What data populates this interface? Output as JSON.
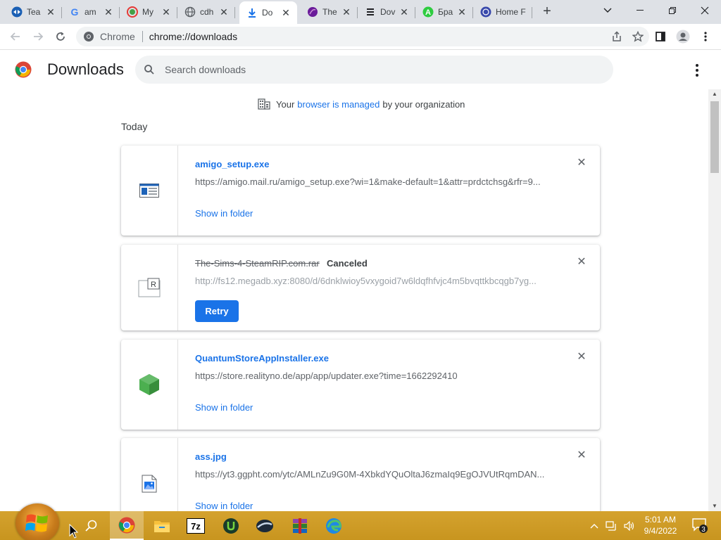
{
  "browser": {
    "tabs": [
      {
        "title": "Tea",
        "icon": "teamviewer-icon",
        "color": "#1a5fb4"
      },
      {
        "title": "am",
        "icon": "google-icon",
        "color": "#4285f4"
      },
      {
        "title": "My",
        "icon": "mywot-icon",
        "color": "#e53935"
      },
      {
        "title": "cdh",
        "icon": "globe-icon",
        "color": "#5f6368"
      },
      {
        "title": "Do",
        "icon": "download-icon",
        "color": "#1a73e8",
        "active": true
      },
      {
        "title": "The",
        "icon": "purple-orb-icon",
        "color": "#6a1b9a"
      },
      {
        "title": "Dov",
        "icon": "stack-icon",
        "color": "#202124"
      },
      {
        "title": "Бра",
        "icon": "amigo-icon",
        "color": "#2ecc40"
      },
      {
        "title": "Home F",
        "icon": "site-icon",
        "color": "#3949ab"
      }
    ],
    "new_tab": "+",
    "url_chip": "Chrome",
    "url": "chrome://downloads"
  },
  "page": {
    "title": "Downloads",
    "search_placeholder": "Search downloads",
    "managed": {
      "before": "Your",
      "link": "browser is managed",
      "after": "by your organization"
    },
    "date_header": "Today",
    "downloads": [
      {
        "filename": "amigo_setup.exe",
        "url": "https://amigo.mail.ru/amigo_setup.exe?wi=1&make-default=1&attr=prdctchsg&rfr=9...",
        "action": "Show in folder",
        "icon": "exe-window-icon"
      },
      {
        "filename": "The-Sims-4-SteamRIP.com.rar",
        "status": "Canceled",
        "url": "http://fs12.megadb.xyz:8080/d/6dnklwioy5vxygoid7w6ldqfhfvjc4m5bvqttkbcqgb7yg...",
        "action": "Retry",
        "icon": "rar-file-icon"
      },
      {
        "filename": "QuantumStoreAppInstaller.exe",
        "url": "https://store.realityno.de/app/app/updater.exe?time=1662292410",
        "action": "Show in folder",
        "icon": "green-cube-icon"
      },
      {
        "filename": "ass.jpg",
        "url": "https://yt3.ggpht.com/ytc/AMLnZu9G0M-4XbkdYQuOltaJ6zmaIq9EgOJVUtRqmDAN...",
        "action": "Show in folder",
        "icon": "image-file-icon"
      }
    ]
  },
  "taskbar": {
    "apps": [
      "chrome-icon",
      "file-explorer-icon",
      "7zip-icon",
      "utorrent-icon",
      "vpn-icon",
      "winrar-icon",
      "edge-icon"
    ],
    "seven_zip_label": "7z",
    "time": "5:01 AM",
    "date": "9/4/2022",
    "notification_count": "3"
  },
  "colors": {
    "accent": "#1a73e8",
    "taskbar": "#c8951f",
    "tabstrip": "#dee1e6"
  }
}
